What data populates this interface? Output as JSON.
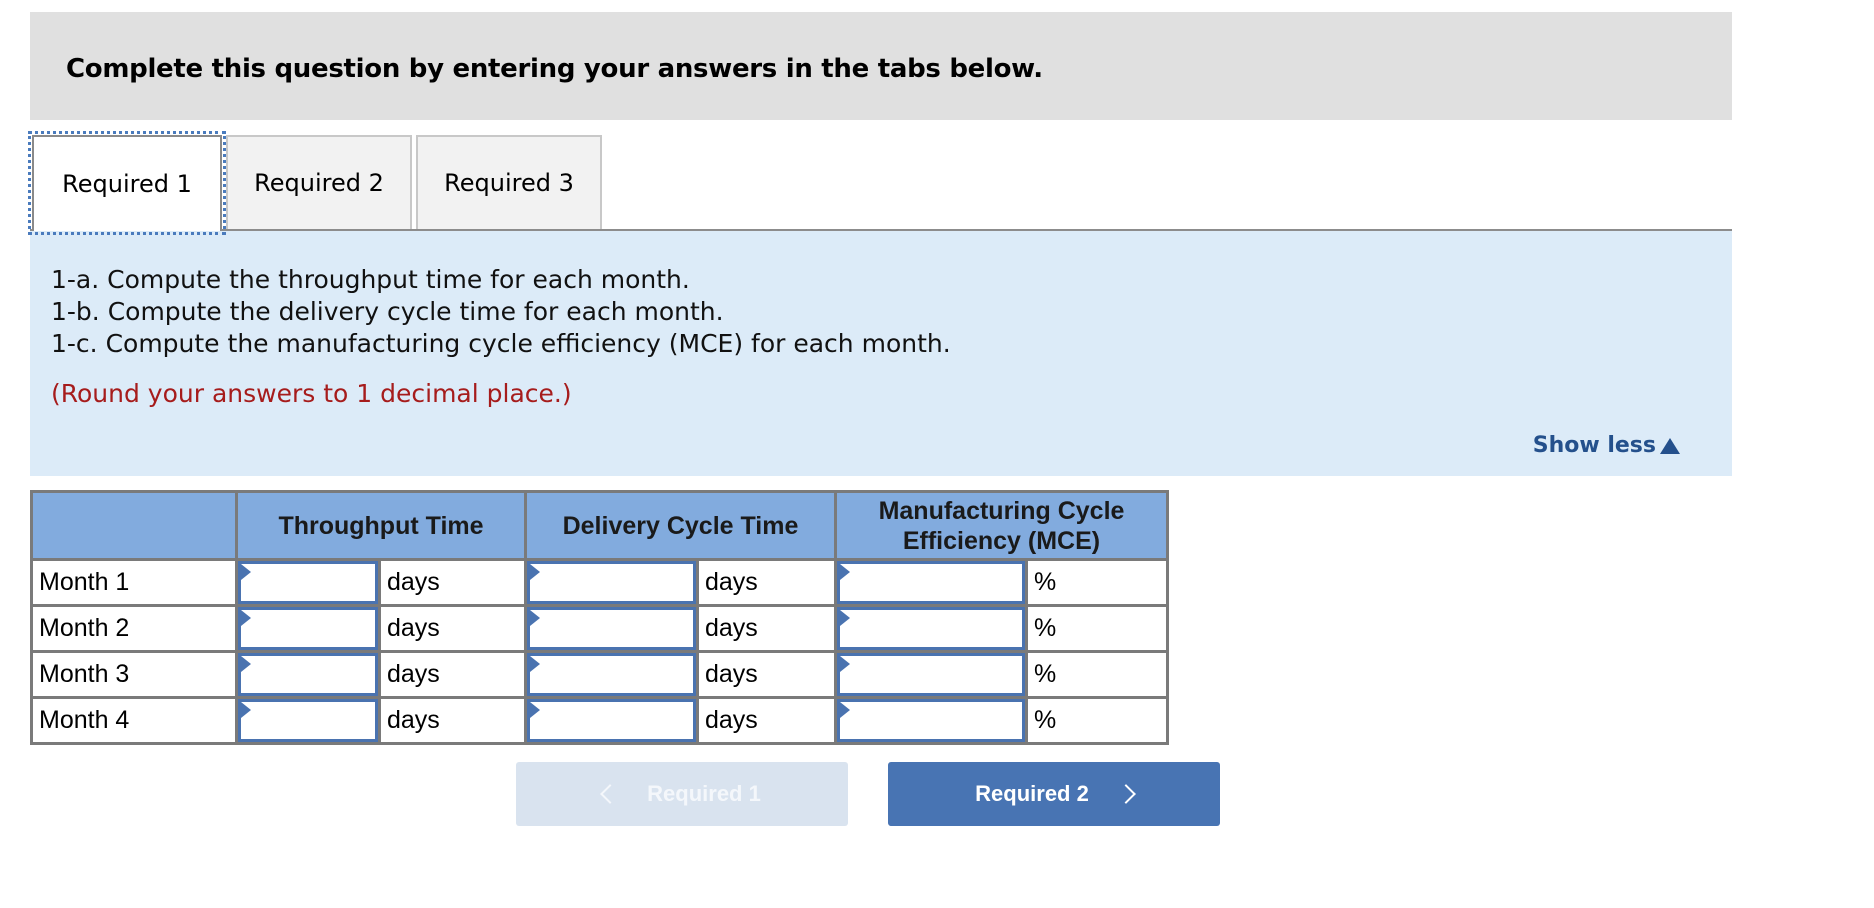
{
  "header": {
    "title": "Complete this question by entering your answers in the tabs below."
  },
  "tabs": [
    {
      "label": "Required 1",
      "active": true
    },
    {
      "label": "Required 2",
      "active": false
    },
    {
      "label": "Required 3",
      "active": false
    }
  ],
  "instructions": {
    "lines": [
      "1-a. Compute the throughput time for each month.",
      "1-b. Compute the delivery cycle time for each month.",
      "1-c. Compute the manufacturing cycle efficiency (MCE) for each month."
    ],
    "note": "(Round your answers to 1 decimal place.)",
    "show_less_label": "Show less",
    "show_less_icon": "triangle-up-icon"
  },
  "table": {
    "headers": [
      "",
      "Throughput Time",
      "Delivery Cycle Time",
      "Manufacturing Cycle Efficiency (MCE)"
    ],
    "header_mce_line1": "Manufacturing Cycle",
    "header_mce_line2": "Efficiency (MCE)",
    "units": {
      "throughput": "days",
      "delivery": "days",
      "mce": "%"
    },
    "rows": [
      {
        "label": "Month 1",
        "throughput": "",
        "delivery": "",
        "mce": ""
      },
      {
        "label": "Month 2",
        "throughput": "",
        "delivery": "",
        "mce": ""
      },
      {
        "label": "Month 3",
        "throughput": "",
        "delivery": "",
        "mce": ""
      },
      {
        "label": "Month 4",
        "throughput": "",
        "delivery": "",
        "mce": ""
      }
    ]
  },
  "navigation": {
    "prev_label": "Required 1",
    "prev_disabled": true,
    "next_label": "Required 2"
  },
  "colors": {
    "header_bg": "#e0e0e0",
    "instructions_bg": "#dcebf8",
    "note_red": "#a61c1c",
    "table_header_bg": "#82abde",
    "input_border": "#4a73b0",
    "next_button": "#4874b3",
    "prev_button_disabled": "#d9e3ef",
    "link_blue": "#24508c"
  }
}
